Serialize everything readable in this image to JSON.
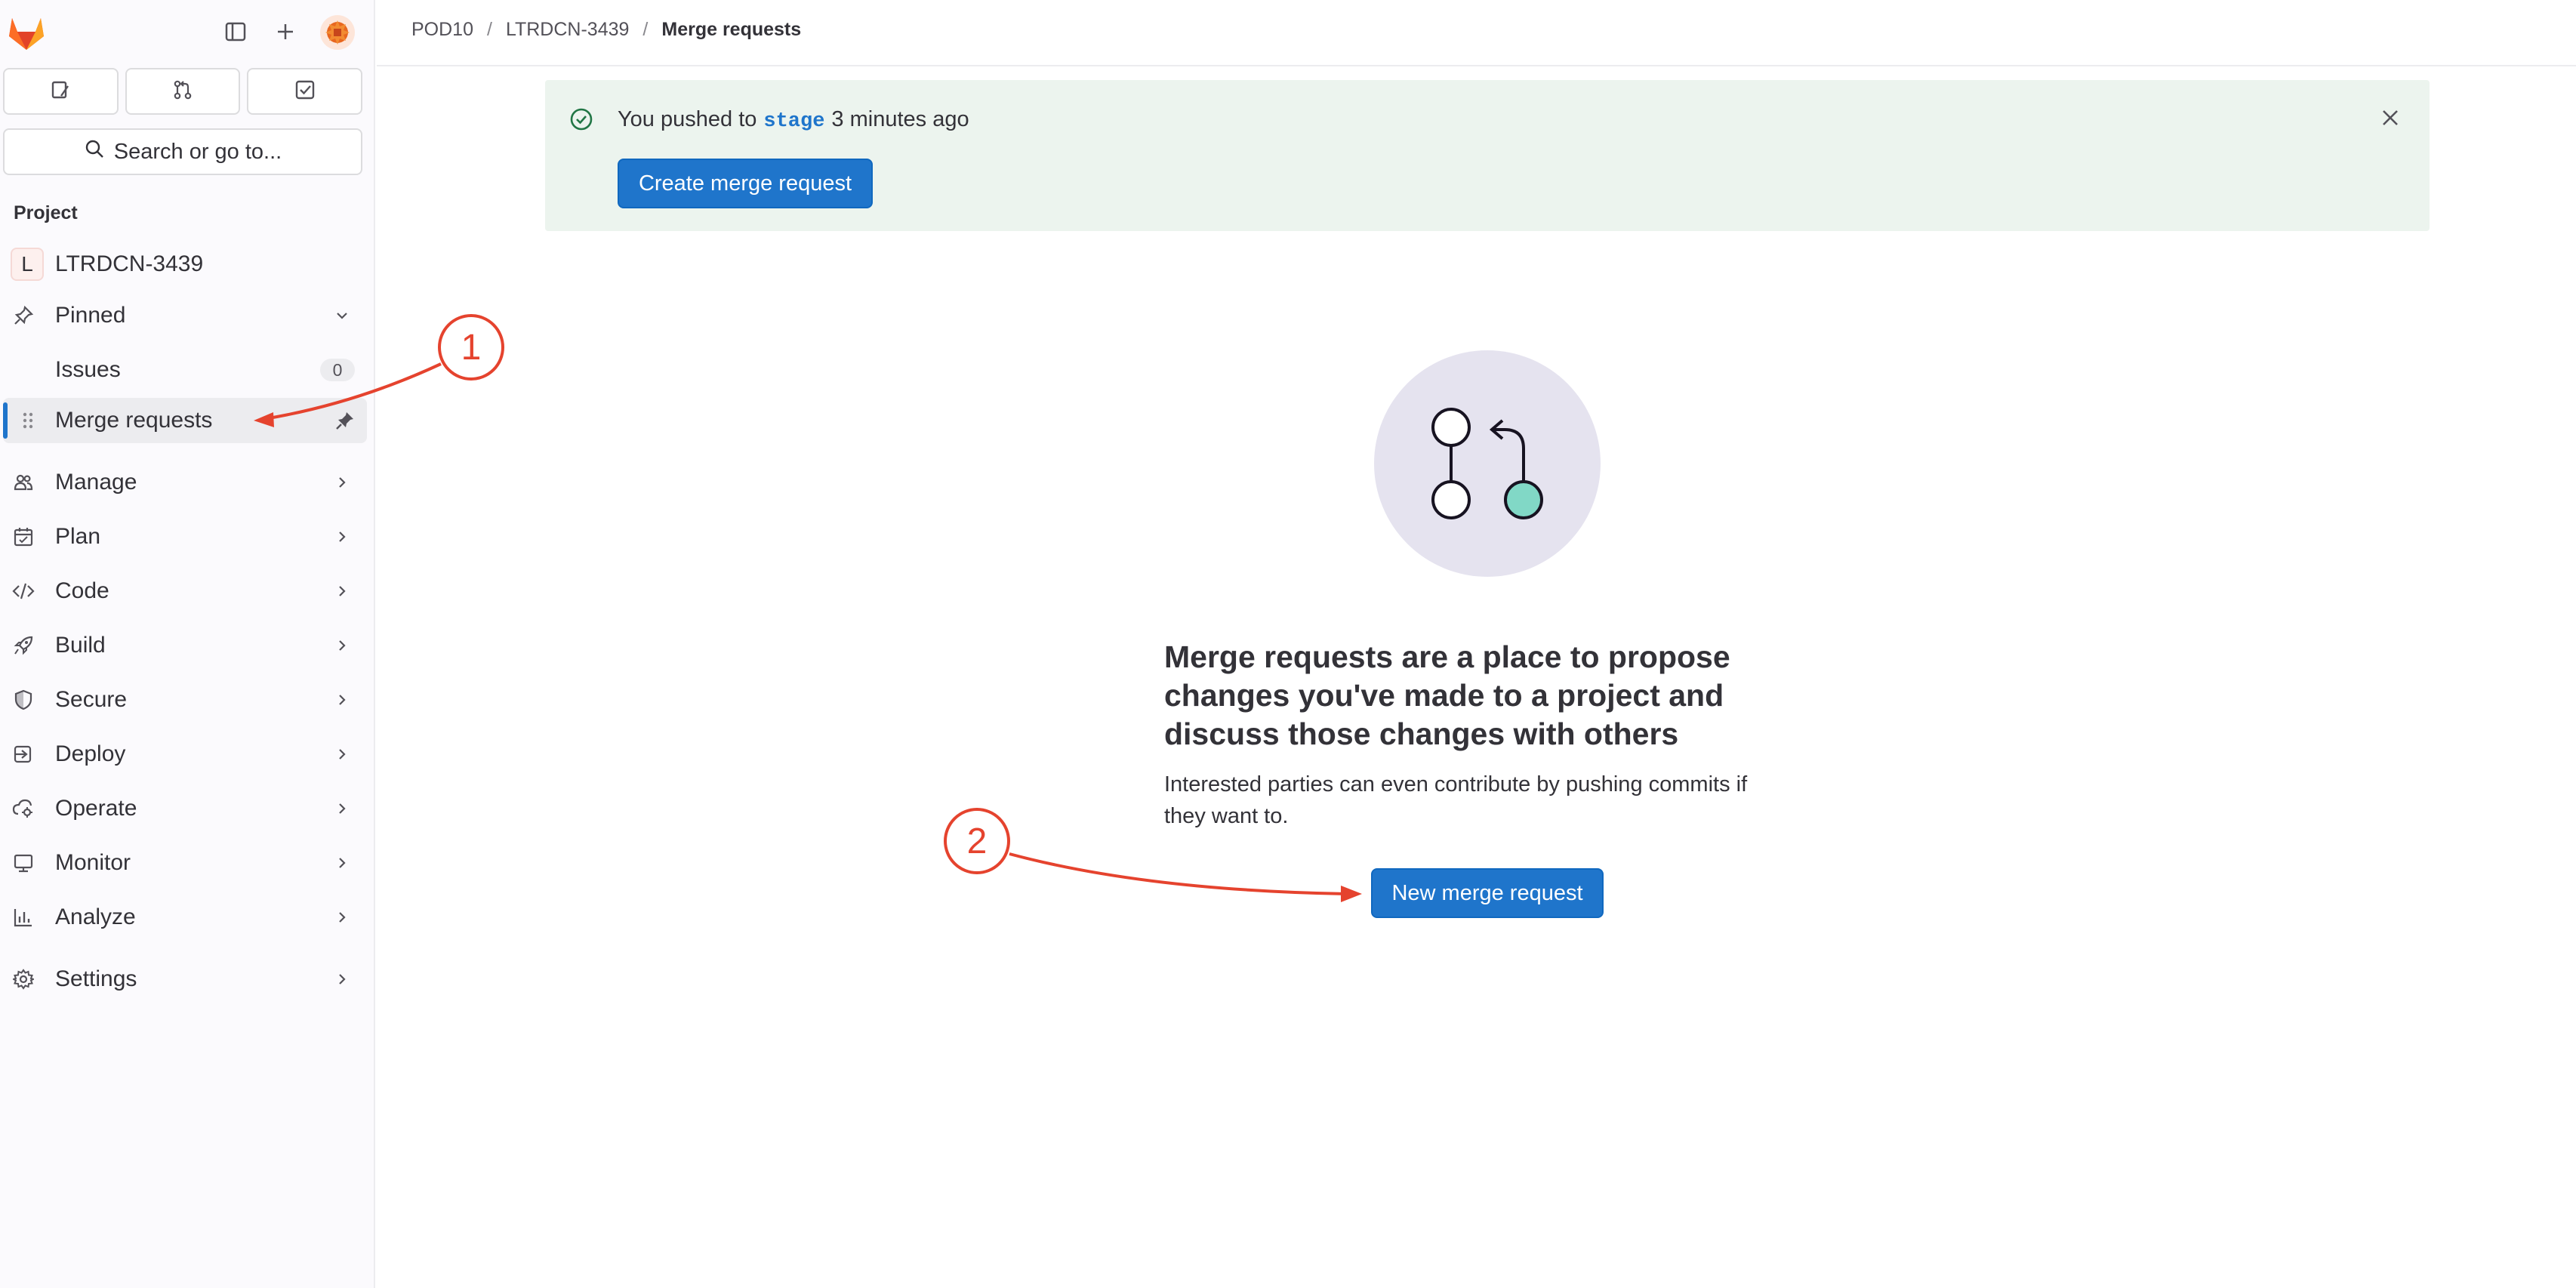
{
  "breadcrumb": [
    "POD10",
    "LTRDCN-3439",
    "Merge requests"
  ],
  "sidebar": {
    "search_label": "Search or go to...",
    "section_title": "Project",
    "project_initial": "L",
    "project_name": "LTRDCN-3439",
    "pinned_label": "Pinned",
    "pinned_items": [
      {
        "label": "Issues",
        "badge": "0"
      },
      {
        "label": "Merge requests"
      }
    ],
    "items": [
      {
        "label": "Manage",
        "icon": "users-icon"
      },
      {
        "label": "Plan",
        "icon": "calendar-icon"
      },
      {
        "label": "Code",
        "icon": "code-icon"
      },
      {
        "label": "Build",
        "icon": "rocket-icon"
      },
      {
        "label": "Secure",
        "icon": "shield-icon"
      },
      {
        "label": "Deploy",
        "icon": "deploy-icon"
      },
      {
        "label": "Operate",
        "icon": "cloud-gear-icon"
      },
      {
        "label": "Monitor",
        "icon": "monitor-icon"
      },
      {
        "label": "Analyze",
        "icon": "chart-icon"
      },
      {
        "label": "Settings",
        "icon": "gear-icon"
      }
    ]
  },
  "alert": {
    "prefix": "You pushed to",
    "branch": "stage",
    "suffix": "3 minutes ago",
    "button": "Create merge request"
  },
  "empty_state": {
    "title": "Merge requests are a place to propose changes you've made to a project and discuss those changes with others",
    "description": "Interested parties can even contribute by pushing commits if they want to.",
    "button": "New merge request"
  },
  "annotations": [
    "1",
    "2"
  ],
  "colors": {
    "accent": "#1f75cb",
    "annotation": "#e5432e",
    "alert_bg": "#ecf4ee",
    "teal": "#81d8c6"
  }
}
